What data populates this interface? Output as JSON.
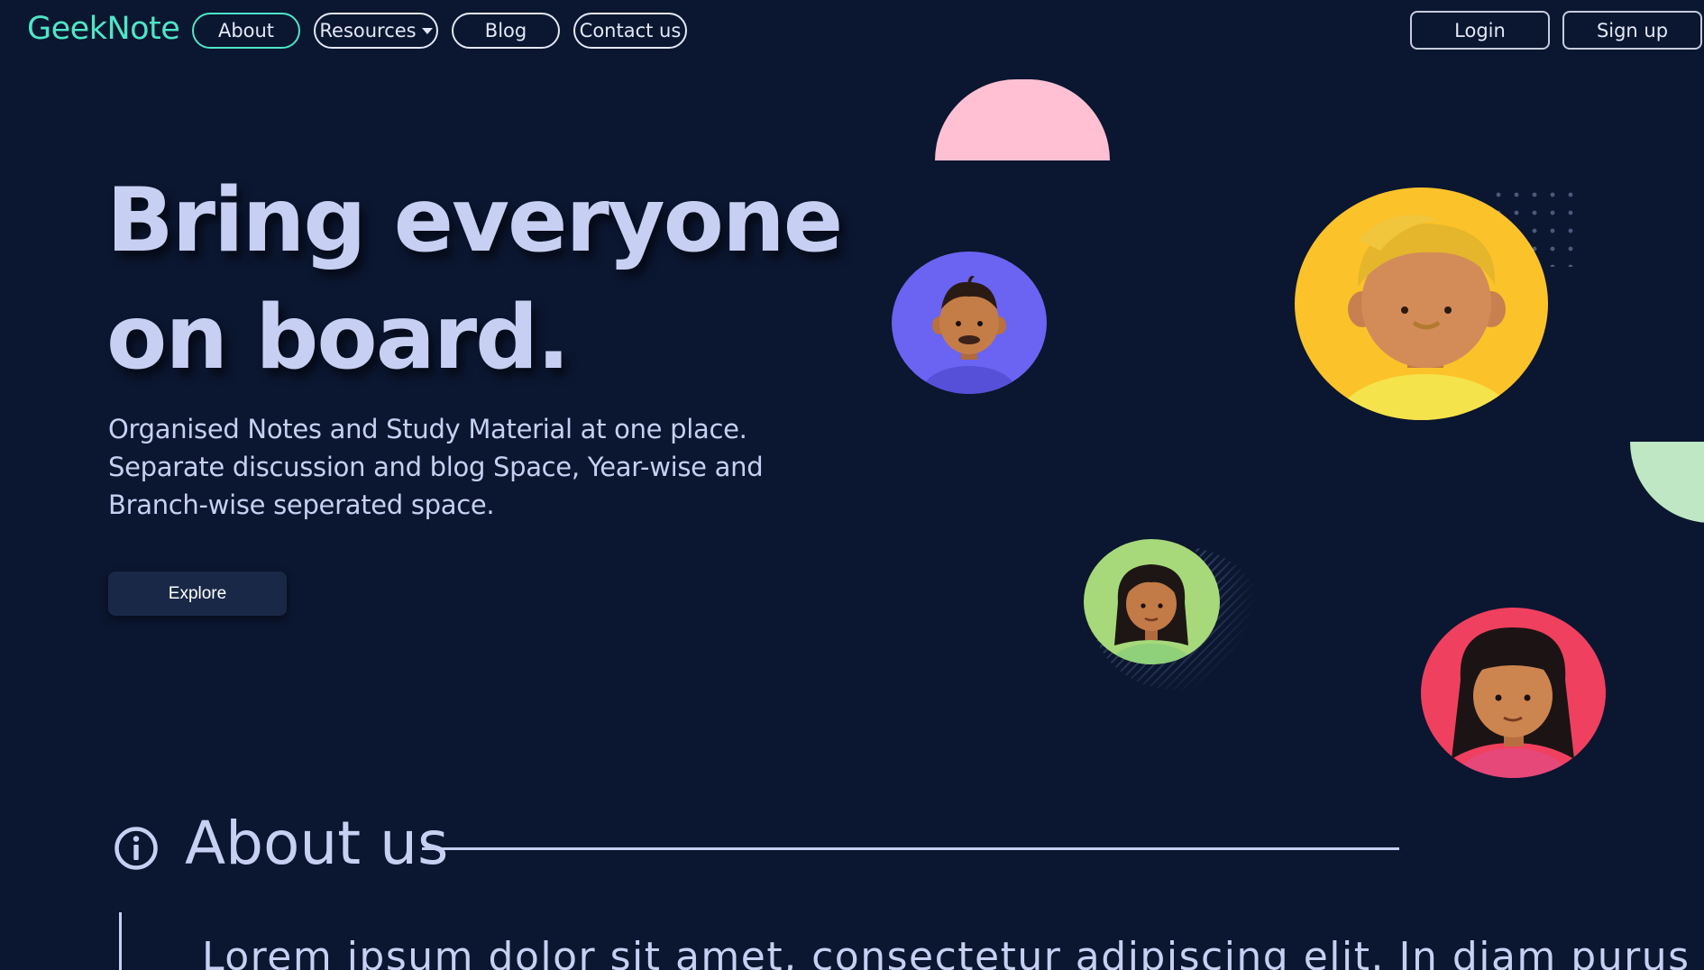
{
  "nav": {
    "brand": "GeekNote",
    "items": [
      {
        "label": "About"
      },
      {
        "label": "Resources"
      },
      {
        "label": "Blog"
      },
      {
        "label": "Contact us"
      }
    ],
    "login": "Login",
    "signup": "Sign up"
  },
  "hero": {
    "title_line1": "Bring everyone",
    "title_line2": "on board.",
    "subtitle": "Organised Notes and Study Material at one place. Separate discussion and blog Space, Year-wise and Branch-wise seperated space.",
    "cta": "Explore"
  },
  "about": {
    "title": "About us",
    "text": "Lorem ipsum dolor sit amet, consectetur adipiscing elit. In diam purus"
  },
  "colors": {
    "background": "#0b1630",
    "brand": "#4ee6c6",
    "text": "#c7d0f2"
  }
}
